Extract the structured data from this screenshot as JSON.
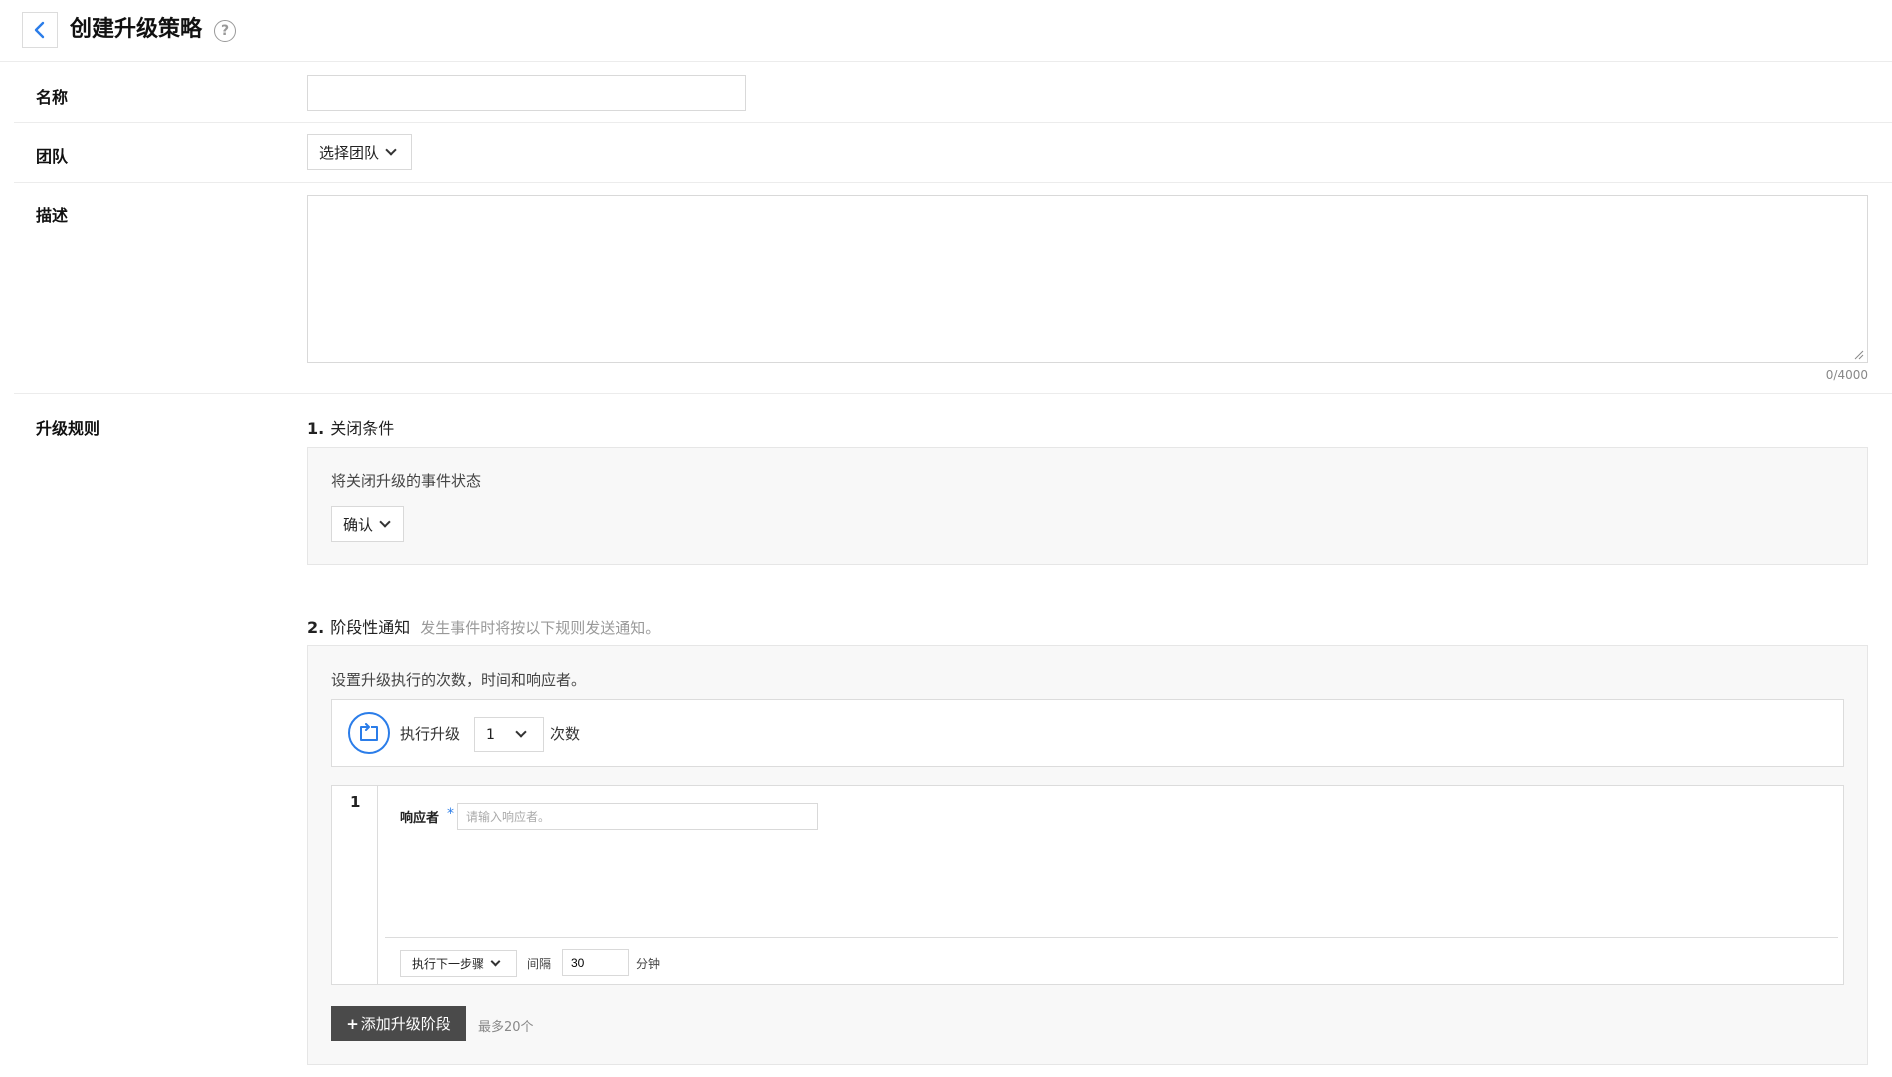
{
  "header": {
    "title": "创建升级策略",
    "back_icon": "chevron-left-icon",
    "help_icon": "question-circle-icon",
    "help_glyph": "?"
  },
  "form": {
    "name_label": "名称",
    "name_value": "",
    "team_label": "团队",
    "team_select_value": "选择团队",
    "description_label": "描述",
    "description_value": "",
    "char_count": "0/4000",
    "rules_label": "升级规则"
  },
  "section1": {
    "number": "1.",
    "title": "关闭条件",
    "description": "将关闭升级的事件状态",
    "status_value": "确认"
  },
  "section2": {
    "number": "2.",
    "title": "阶段性通知",
    "hint": "发生事件时将按以下规则发送通知。",
    "description": "设置升级执行的次数，时间和响应者。",
    "exec_label": "执行升级",
    "exec_count": "1",
    "times_label": "次数",
    "repeat_icon": "repeat-icon",
    "step": {
      "index": "1",
      "responder_label": "响应者",
      "required_mark": "*",
      "responder_placeholder": "请输入响应者。",
      "next_action": "执行下一步骤",
      "interval_label": "间隔",
      "interval_value": "30",
      "minutes_label": "分钟"
    },
    "add_button_plus": "+",
    "add_button_label": "添加升级阶段",
    "max_hint": "最多20个"
  },
  "colors": {
    "accent": "#2b7de9",
    "button_dark": "#4a4a4a",
    "panel_bg": "#f8f8f8",
    "border": "#d9d9d9"
  }
}
